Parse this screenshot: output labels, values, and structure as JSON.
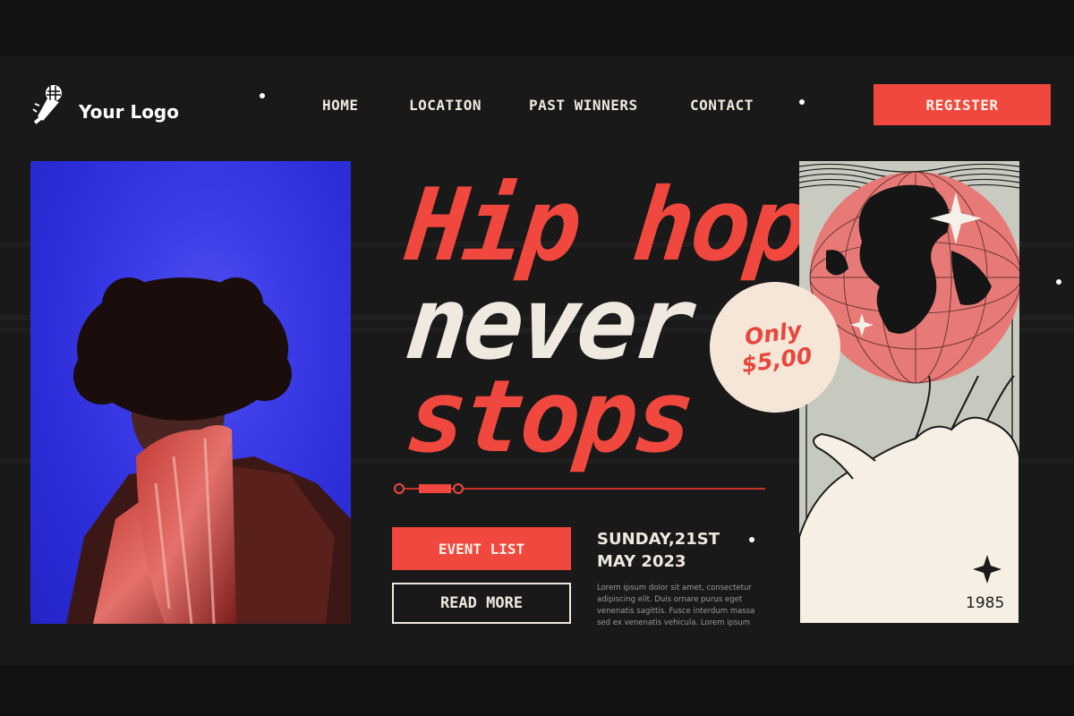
{
  "logo": {
    "text": "Your Logo"
  },
  "nav": {
    "items": [
      {
        "label": "HOME"
      },
      {
        "label": "LOCATION"
      },
      {
        "label": "PAST WINNERS"
      },
      {
        "label": "CONTACT"
      }
    ],
    "register_label": "REGISTER"
  },
  "hero": {
    "headline_line1": "Hip hop",
    "headline_line2": "never",
    "headline_line3": "stops",
    "event_button": "EVENT LIST",
    "read_more_button": "READ MORE",
    "date_line1": "SUNDAY,21ST",
    "date_line2": "MAY 2023",
    "description": "Lorem ipsum dolor sit amet, consectetur adipiscing elit. Duis ornare purus eget venenatis sagittis. Fusce interdum massa sed ex venenatis vehicula. Lorem ipsum"
  },
  "badge": {
    "line1": "Only",
    "line2": "$5,00"
  },
  "artwork": {
    "year": "1985"
  },
  "colors": {
    "accent": "#f0483e",
    "background": "#191919",
    "cream": "#efe9df",
    "photo_blue": "#3a3ae6",
    "globe_pink": "#e77a77"
  }
}
